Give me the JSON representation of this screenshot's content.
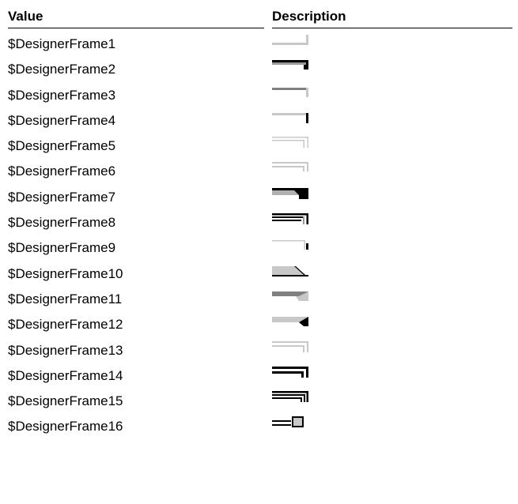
{
  "header": {
    "value_label": "Value",
    "description_label": "Description"
  },
  "rows": [
    {
      "value": "$DesignerFrame1",
      "icon": "frame-style-1-icon"
    },
    {
      "value": "$DesignerFrame2",
      "icon": "frame-style-2-icon"
    },
    {
      "value": "$DesignerFrame3",
      "icon": "frame-style-3-icon"
    },
    {
      "value": "$DesignerFrame4",
      "icon": "frame-style-4-icon"
    },
    {
      "value": "$DesignerFrame5",
      "icon": "frame-style-5-icon"
    },
    {
      "value": "$DesignerFrame6",
      "icon": "frame-style-6-icon"
    },
    {
      "value": "$DesignerFrame7",
      "icon": "frame-style-7-icon"
    },
    {
      "value": "$DesignerFrame8",
      "icon": "frame-style-8-icon"
    },
    {
      "value": "$DesignerFrame9",
      "icon": "frame-style-9-icon"
    },
    {
      "value": "$DesignerFrame10",
      "icon": "frame-style-10-icon"
    },
    {
      "value": "$DesignerFrame11",
      "icon": "frame-style-11-icon"
    },
    {
      "value": "$DesignerFrame12",
      "icon": "frame-style-12-icon"
    },
    {
      "value": "$DesignerFrame13",
      "icon": "frame-style-13-icon"
    },
    {
      "value": "$DesignerFrame14",
      "icon": "frame-style-14-icon"
    },
    {
      "value": "$DesignerFrame15",
      "icon": "frame-style-15-icon"
    },
    {
      "value": "$DesignerFrame16",
      "icon": "frame-style-16-icon"
    }
  ]
}
